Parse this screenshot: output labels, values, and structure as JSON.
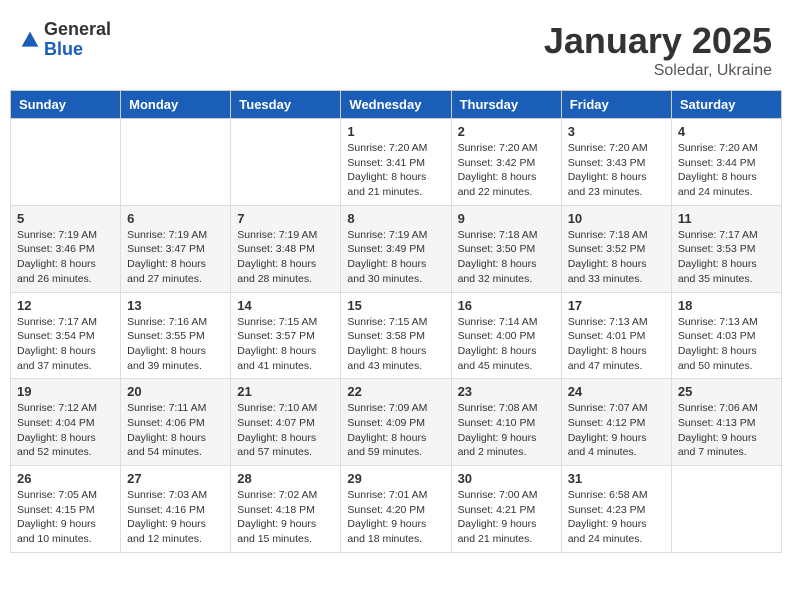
{
  "header": {
    "logo_general": "General",
    "logo_blue": "Blue",
    "month": "January 2025",
    "location": "Soledar, Ukraine"
  },
  "days_of_week": [
    "Sunday",
    "Monday",
    "Tuesday",
    "Wednesday",
    "Thursday",
    "Friday",
    "Saturday"
  ],
  "weeks": [
    [
      {
        "day": "",
        "info": ""
      },
      {
        "day": "",
        "info": ""
      },
      {
        "day": "",
        "info": ""
      },
      {
        "day": "1",
        "info": "Sunrise: 7:20 AM\nSunset: 3:41 PM\nDaylight: 8 hours and 21 minutes."
      },
      {
        "day": "2",
        "info": "Sunrise: 7:20 AM\nSunset: 3:42 PM\nDaylight: 8 hours and 22 minutes."
      },
      {
        "day": "3",
        "info": "Sunrise: 7:20 AM\nSunset: 3:43 PM\nDaylight: 8 hours and 23 minutes."
      },
      {
        "day": "4",
        "info": "Sunrise: 7:20 AM\nSunset: 3:44 PM\nDaylight: 8 hours and 24 minutes."
      }
    ],
    [
      {
        "day": "5",
        "info": "Sunrise: 7:19 AM\nSunset: 3:46 PM\nDaylight: 8 hours and 26 minutes."
      },
      {
        "day": "6",
        "info": "Sunrise: 7:19 AM\nSunset: 3:47 PM\nDaylight: 8 hours and 27 minutes."
      },
      {
        "day": "7",
        "info": "Sunrise: 7:19 AM\nSunset: 3:48 PM\nDaylight: 8 hours and 28 minutes."
      },
      {
        "day": "8",
        "info": "Sunrise: 7:19 AM\nSunset: 3:49 PM\nDaylight: 8 hours and 30 minutes."
      },
      {
        "day": "9",
        "info": "Sunrise: 7:18 AM\nSunset: 3:50 PM\nDaylight: 8 hours and 32 minutes."
      },
      {
        "day": "10",
        "info": "Sunrise: 7:18 AM\nSunset: 3:52 PM\nDaylight: 8 hours and 33 minutes."
      },
      {
        "day": "11",
        "info": "Sunrise: 7:17 AM\nSunset: 3:53 PM\nDaylight: 8 hours and 35 minutes."
      }
    ],
    [
      {
        "day": "12",
        "info": "Sunrise: 7:17 AM\nSunset: 3:54 PM\nDaylight: 8 hours and 37 minutes."
      },
      {
        "day": "13",
        "info": "Sunrise: 7:16 AM\nSunset: 3:55 PM\nDaylight: 8 hours and 39 minutes."
      },
      {
        "day": "14",
        "info": "Sunrise: 7:15 AM\nSunset: 3:57 PM\nDaylight: 8 hours and 41 minutes."
      },
      {
        "day": "15",
        "info": "Sunrise: 7:15 AM\nSunset: 3:58 PM\nDaylight: 8 hours and 43 minutes."
      },
      {
        "day": "16",
        "info": "Sunrise: 7:14 AM\nSunset: 4:00 PM\nDaylight: 8 hours and 45 minutes."
      },
      {
        "day": "17",
        "info": "Sunrise: 7:13 AM\nSunset: 4:01 PM\nDaylight: 8 hours and 47 minutes."
      },
      {
        "day": "18",
        "info": "Sunrise: 7:13 AM\nSunset: 4:03 PM\nDaylight: 8 hours and 50 minutes."
      }
    ],
    [
      {
        "day": "19",
        "info": "Sunrise: 7:12 AM\nSunset: 4:04 PM\nDaylight: 8 hours and 52 minutes."
      },
      {
        "day": "20",
        "info": "Sunrise: 7:11 AM\nSunset: 4:06 PM\nDaylight: 8 hours and 54 minutes."
      },
      {
        "day": "21",
        "info": "Sunrise: 7:10 AM\nSunset: 4:07 PM\nDaylight: 8 hours and 57 minutes."
      },
      {
        "day": "22",
        "info": "Sunrise: 7:09 AM\nSunset: 4:09 PM\nDaylight: 8 hours and 59 minutes."
      },
      {
        "day": "23",
        "info": "Sunrise: 7:08 AM\nSunset: 4:10 PM\nDaylight: 9 hours and 2 minutes."
      },
      {
        "day": "24",
        "info": "Sunrise: 7:07 AM\nSunset: 4:12 PM\nDaylight: 9 hours and 4 minutes."
      },
      {
        "day": "25",
        "info": "Sunrise: 7:06 AM\nSunset: 4:13 PM\nDaylight: 9 hours and 7 minutes."
      }
    ],
    [
      {
        "day": "26",
        "info": "Sunrise: 7:05 AM\nSunset: 4:15 PM\nDaylight: 9 hours and 10 minutes."
      },
      {
        "day": "27",
        "info": "Sunrise: 7:03 AM\nSunset: 4:16 PM\nDaylight: 9 hours and 12 minutes."
      },
      {
        "day": "28",
        "info": "Sunrise: 7:02 AM\nSunset: 4:18 PM\nDaylight: 9 hours and 15 minutes."
      },
      {
        "day": "29",
        "info": "Sunrise: 7:01 AM\nSunset: 4:20 PM\nDaylight: 9 hours and 18 minutes."
      },
      {
        "day": "30",
        "info": "Sunrise: 7:00 AM\nSunset: 4:21 PM\nDaylight: 9 hours and 21 minutes."
      },
      {
        "day": "31",
        "info": "Sunrise: 6:58 AM\nSunset: 4:23 PM\nDaylight: 9 hours and 24 minutes."
      },
      {
        "day": "",
        "info": ""
      }
    ]
  ]
}
